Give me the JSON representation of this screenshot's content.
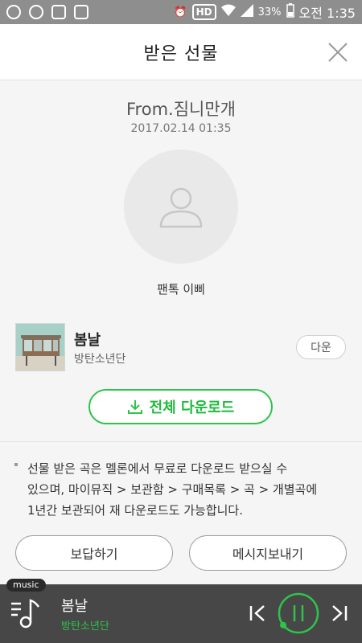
{
  "status_bar": {
    "battery": "33%",
    "time": "오전 1:35",
    "hd_badge": "HD"
  },
  "header": {
    "title": "받은 선물",
    "close_icon": "close-icon"
  },
  "gift": {
    "from": "From.짐니만개",
    "date": "2017.02.14 01:35",
    "avatar_icon": "user-icon",
    "name": "팬톡 이삐"
  },
  "song": {
    "title": "봄날",
    "artist": "방탄소년단",
    "download_label": "다운"
  },
  "download_all": {
    "label": "전체 다운로드",
    "icon": "download-icon"
  },
  "notice": {
    "line1": "선물 받은 곡은 멜론에서 무료로 다운로드 받으실 수",
    "line2": "있으며, 마이뮤직 > 보관함 > 구매목록 > 곡 > 개별곡에",
    "line3": "1년간 보관되어 재 다운로드도 가능합니다."
  },
  "actions": {
    "reply": "보답하기",
    "message": "메시지보내기"
  },
  "player": {
    "tag": "music",
    "title": "봄날",
    "artist": "방탄소년단",
    "playback_progress": 0.02
  },
  "colors": {
    "accent": "#2ec44a",
    "status_bar": "#8e8e8e",
    "player_bg": "#474747"
  }
}
